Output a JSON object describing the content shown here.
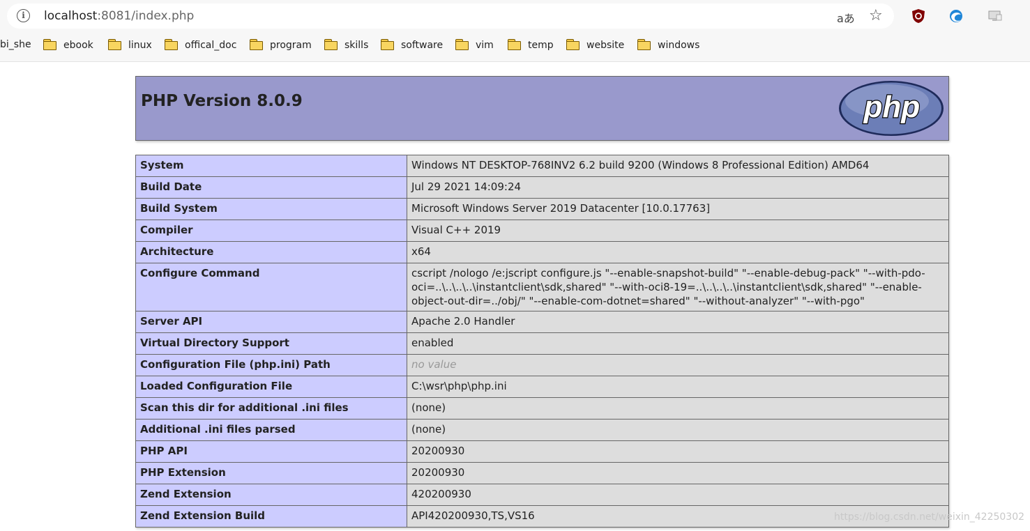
{
  "browser": {
    "url_host": "localhost",
    "url_rest": ":8081/index.php",
    "read_aloud_label": "aあ",
    "bookmarks": [
      {
        "label": "bi_she",
        "folder": false
      },
      {
        "label": "ebook",
        "folder": true
      },
      {
        "label": "linux",
        "folder": true
      },
      {
        "label": "offical_doc",
        "folder": true
      },
      {
        "label": "program",
        "folder": true
      },
      {
        "label": "skills",
        "folder": true
      },
      {
        "label": "software",
        "folder": true
      },
      {
        "label": "vim",
        "folder": true
      },
      {
        "label": "temp",
        "folder": true
      },
      {
        "label": "website",
        "folder": true
      },
      {
        "label": "windows",
        "folder": true
      }
    ]
  },
  "phpinfo": {
    "title": "PHP Version 8.0.9",
    "logo_text": "php",
    "rows": [
      {
        "key": "System",
        "value": "Windows NT DESKTOP-768INV2 6.2 build 9200 (Windows 8 Professional Edition) AMD64"
      },
      {
        "key": "Build Date",
        "value": "Jul 29 2021 14:09:24"
      },
      {
        "key": "Build System",
        "value": "Microsoft Windows Server 2019 Datacenter [10.0.17763]"
      },
      {
        "key": "Compiler",
        "value": "Visual C++ 2019"
      },
      {
        "key": "Architecture",
        "value": "x64"
      },
      {
        "key": "Configure Command",
        "value": "cscript /nologo /e:jscript configure.js \"--enable-snapshot-build\" \"--enable-debug-pack\" \"--with-pdo-oci=..\\..\\..\\..\\instantclient\\sdk,shared\" \"--with-oci8-19=..\\..\\..\\..\\instantclient\\sdk,shared\" \"--enable-object-out-dir=../obj/\" \"--enable-com-dotnet=shared\" \"--without-analyzer\" \"--with-pgo\""
      },
      {
        "key": "Server API",
        "value": "Apache 2.0 Handler"
      },
      {
        "key": "Virtual Directory Support",
        "value": "enabled"
      },
      {
        "key": "Configuration File (php.ini) Path",
        "value": "no value"
      },
      {
        "key": "Loaded Configuration File",
        "value": "C:\\wsr\\php\\php.ini"
      },
      {
        "key": "Scan this dir for additional .ini files",
        "value": "(none)"
      },
      {
        "key": "Additional .ini files parsed",
        "value": "(none)"
      },
      {
        "key": "PHP API",
        "value": "20200930"
      },
      {
        "key": "PHP Extension",
        "value": "20200930"
      },
      {
        "key": "Zend Extension",
        "value": "420200930"
      },
      {
        "key": "Zend Extension Build",
        "value": "API420200930,TS,VS16"
      }
    ]
  },
  "watermark": "https://blog.csdn.net/weixin_42250302"
}
